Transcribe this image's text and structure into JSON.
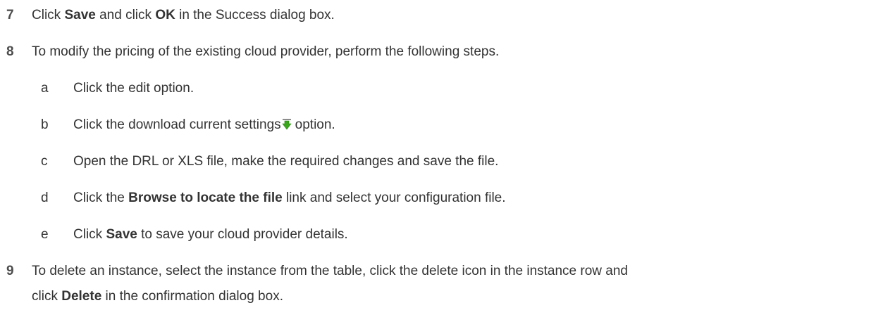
{
  "steps": [
    {
      "number": "7",
      "parts": [
        "Click ",
        "Save",
        " and click ",
        "OK",
        " in the Success dialog box."
      ]
    },
    {
      "number": "8",
      "text": "To modify the pricing of the existing cloud provider, perform the following steps.",
      "substeps": [
        {
          "letter": "a",
          "text": "Click the edit option."
        },
        {
          "letter": "b",
          "parts": [
            "Click the download current settings",
            "option."
          ],
          "icon": "download-arrow-icon"
        },
        {
          "letter": "c",
          "text": "Open the DRL or XLS file, make the required changes and save the file."
        },
        {
          "letter": "d",
          "parts": [
            "Click the ",
            "Browse to locate the file",
            " link and select your configuration file."
          ]
        },
        {
          "letter": "e",
          "parts": [
            "Click ",
            "Save",
            " to save your cloud provider details."
          ]
        }
      ]
    },
    {
      "number": "9",
      "line1": "To delete an instance, select the instance from the table, click the delete icon in the instance row and",
      "line2_parts": [
        "click ",
        "Delete",
        " in the confirmation dialog box."
      ]
    }
  ],
  "colors": {
    "text": "#333333",
    "number": "#4d4d4d",
    "icon_green": "#3aa61b",
    "icon_grey": "#8c8c8c"
  }
}
